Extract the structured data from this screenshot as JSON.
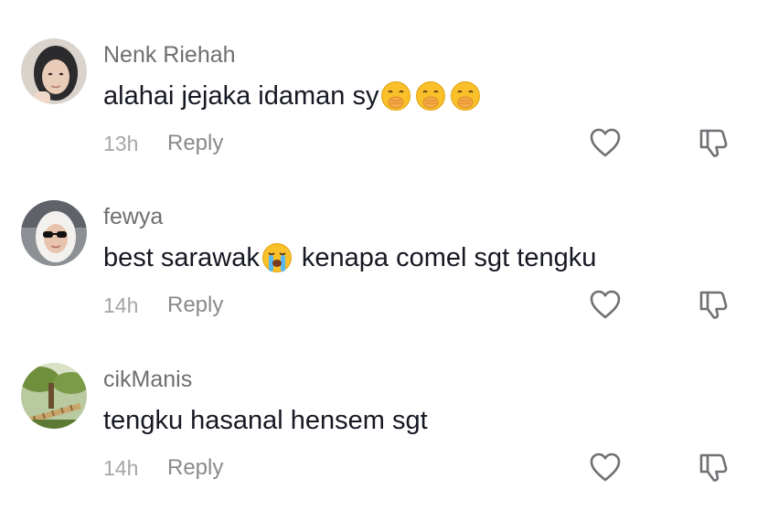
{
  "comments": [
    {
      "username": "Nenk Riehah",
      "text_before": "alahai jejaka idaman sy",
      "emojis_inline": [
        "hand-over-mouth-emoji",
        "hand-over-mouth-emoji",
        "hand-over-mouth-emoji"
      ],
      "text_after": "",
      "time": "13h",
      "reply_label": "Reply"
    },
    {
      "username": "fewya",
      "text_before": "best sarawak",
      "emojis_inline": [
        "loudly-crying-emoji"
      ],
      "text_after": " kenapa comel sgt tengku",
      "time": "14h",
      "reply_label": "Reply"
    },
    {
      "username": "cikManis",
      "text_before": "tengku hasanal hensem sgt",
      "emojis_inline": [],
      "text_after": "",
      "time": "14h",
      "reply_label": "Reply"
    }
  ],
  "icons": {
    "like": "heart-outline-icon",
    "dislike": "thumbs-down-outline-icon"
  },
  "colors": {
    "username": "#6f6f73",
    "text": "#161823",
    "time": "#a6a6aa",
    "reply": "#8a8a8e",
    "icon_stroke": "#707075"
  }
}
